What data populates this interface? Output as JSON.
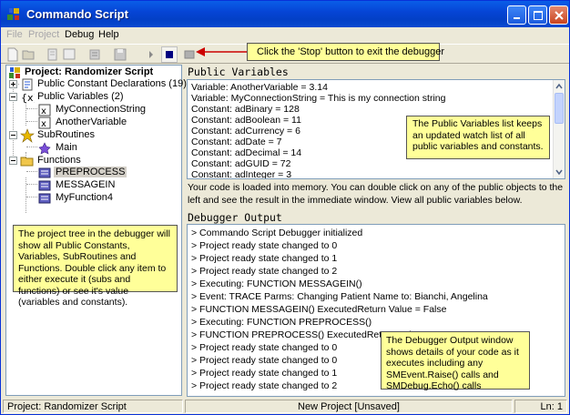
{
  "window": {
    "title": "Commando Script"
  },
  "menu": {
    "items": [
      "File",
      "Project",
      "Debug",
      "Help"
    ]
  },
  "toolbar": {
    "callout": "Click the 'Stop' button to exit the debugger"
  },
  "tree": {
    "root": "Project: Randomizer Script",
    "constants": "Public Constant Declarations (19)",
    "variables": "Public Variables (2)",
    "variable_items": [
      "MyConnectionString",
      "AnotherVariable"
    ],
    "subroutines": "SubRoutines",
    "subroutine_items": [
      "Main"
    ],
    "functions": "Functions",
    "function_items": [
      "PREPROCESS",
      "MESSAGEIN",
      "MyFunction4"
    ],
    "note": "The project tree in the debugger will show all Public Constants, Variables, SubRoutines and Functions.  Double click any item to either execute it (subs and functions) or see it's value (variables and constants)."
  },
  "public_variables": {
    "header": "Public Variables",
    "lines": [
      "Variable: AnotherVariable = 3.14",
      "Variable: MyConnectionString = This is my connection string",
      "Constant: adBinary = 128",
      "Constant: adBoolean = 11",
      "Constant: adCurrency = 6",
      "Constant: adDate = 7",
      "Constant: adDecimal = 14",
      "Constant: adGUID = 72",
      "Constant: adInteger = 3"
    ],
    "note": "The Public Variables list keeps an updated watch list of all public variables and constants."
  },
  "info_text": "Your code is loaded into memory.  You can double click on any of the public objects to the left and see the result in the immediate window.  View all public variables below.",
  "debugger_output": {
    "header": "Debugger Output",
    "lines": [
      "> Commando Script Debugger initialized",
      "> Project ready state changed to 0",
      "> Project ready state changed to 1",
      "> Project ready state changed to 2",
      "> Executing: FUNCTION MESSAGEIN()",
      "> Event: TRACE Parms: Changing Patient Name to: Bianchi, Angelina",
      "> FUNCTION MESSAGEIN() ExecutedReturn Value = False",
      "> Executing: FUNCTION PREPROCESS()",
      "> FUNCTION PREPROCESS() ExecutedReturn Value = True",
      "> Project ready state changed to 0",
      "> Project ready state changed to 0",
      "> Project ready state changed to 1",
      "> Project ready state changed to 2"
    ],
    "note": "The Debugger Output window shows details of your code as it executes including any SMEvent.Raise() calls and SMDebug.Echo() calls"
  },
  "status": {
    "project": "Project: Randomizer Script",
    "file": "New Project [Unsaved]",
    "line": "Ln: 1"
  },
  "colors": {
    "titlebar": "#0a5ee8",
    "note_bg": "#ffff99",
    "stop_icon": "#000080",
    "arrow": "#cc0000"
  },
  "icons": [
    "app-icon",
    "new-icon",
    "open-icon",
    "save-icon",
    "run-icon",
    "stop-icon",
    "minimize-icon",
    "maximize-icon",
    "close-icon",
    "project-icon",
    "constants-icon",
    "variables-icon",
    "subroutines-icon",
    "functions-icon"
  ]
}
